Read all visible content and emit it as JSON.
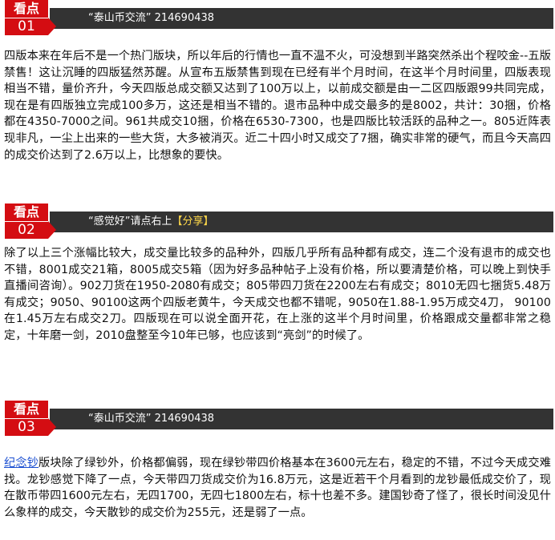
{
  "sections": [
    {
      "badge_label": "看点",
      "badge_number": "01",
      "bar_text": "“泰山币交流” 214690438",
      "paragraph": "四版本来在年后不是一个热门版块，所以年后的行情也一直不温不火，可没想到半路突然杀出个程咬金--五版禁售！这让沉睡的四版猛然苏醒。从宣布五版禁售到现在已经有半个月时间，在这半个月时间里，四版表现相当不错，量价齐升，今天四版总成交额又达到了100万以上，以前成交额是由一二区四版跟99共同完成，现在是有四版独立完成100多万，这还是相当不错的。退市品种中成交最多的是8002，共计：30捆，价格都在4350-7000之间。961共成交10捆，价格在6530-7300，也是四版比较活跃的品种之一。805近阵表现非凡，一尘上出来的一些大货，大多被消灭。近二十四小时又成交了7捆，确实非常的硬气，而且今天高四的成交价达到了2.6万以上，比想象的要快。"
    },
    {
      "badge_label": "看点",
      "badge_number": "02",
      "bar_text_part1": "“感觉好”请点右上",
      "bar_text_part2": "【分享】",
      "paragraph": "除了以上三个涨幅比较大，成交量比较多的品种外，四版几乎所有品种都有成交，连二个没有退市的成交也不错，8001成交21箱，8005成交5箱（因为好多品种帖子上没有价格，所以要清楚价格，可以晚上到快手直播间咨询）。902刀货在1950-2080有成交；805带四刀货在2200左右有成交；8010无四七捆货5.48万有成交；9050、90100这两个四版老黄牛，今天成交也都不错呢，9050在1.88-1.95万成交4刀， 90100在1.45万左右成交2刀。四版现在可以说全面开花，在上涨的这半个月时间里，价格跟成交量都非常之稳定，十年磨一剑，2010盘整至今10年已够，也应该到“亮剑”的时候了。"
    },
    {
      "badge_label": "看点",
      "badge_number": "03",
      "bar_text": "“泰山币交流” 214690438",
      "link_text": "纪念钞",
      "paragraph": "版块除了绿钞外，价格都偏弱，现在绿钞带四价格基本在3600元左右，稳定的不错，不过今天成交难找。龙钞感觉下降了一点，今天带四刀货成交价为16.8万元，这是近若干个月看到的龙钞最低成交价了，现在散币带四1600元左右，无四1700，无四七1800左右，标十也差不多。建国钞奇了怪了，很长时间没见什么象样的成交，今天散钞的成交价为255元，还是弱了一点。"
    }
  ],
  "colors": {
    "badge_red": "#d40d12",
    "bar_dark": "#333333",
    "highlight_yellow": "#ffd84a",
    "link_blue": "#1b4fd1"
  }
}
